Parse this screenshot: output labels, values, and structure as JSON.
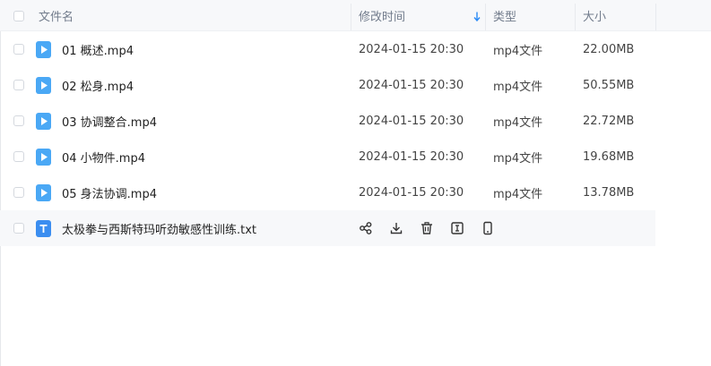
{
  "header": {
    "name_label": "文件名",
    "time_label": "修改时间",
    "type_label": "类型",
    "size_label": "大小"
  },
  "files": [
    {
      "name": "01 概述.mp4",
      "time": "2024-01-15 20:30",
      "type": "mp4文件",
      "size": "22.00MB",
      "icon": "video-file-icon"
    },
    {
      "name": "02 松身.mp4",
      "time": "2024-01-15 20:30",
      "type": "mp4文件",
      "size": "50.55MB",
      "icon": "video-file-icon"
    },
    {
      "name": "03 协调整合.mp4",
      "time": "2024-01-15 20:30",
      "type": "mp4文件",
      "size": "22.72MB",
      "icon": "video-file-icon"
    },
    {
      "name": "04 小物件.mp4",
      "time": "2024-01-15 20:30",
      "type": "mp4文件",
      "size": "19.68MB",
      "icon": "video-file-icon"
    },
    {
      "name": "05 身法协调.mp4",
      "time": "2024-01-15 20:30",
      "type": "mp4文件",
      "size": "13.78MB",
      "icon": "video-file-icon"
    }
  ],
  "hovered_file": {
    "name": "太极拳与西斯特玛听劲敏感性训练.txt",
    "icon": "text-file-icon",
    "actions": [
      "share-icon",
      "download-icon",
      "delete-icon",
      "rename-icon",
      "phone-icon"
    ]
  },
  "colors": {
    "video_icon": "#4aa8f5",
    "text_icon": "#3b8ef0",
    "sort_arrow": "#2a8af6",
    "header_bg": "#f7f8fa",
    "hover_bg": "#f7f8fa"
  }
}
